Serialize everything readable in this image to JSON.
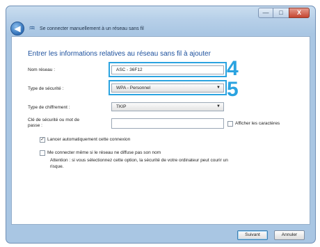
{
  "window": {
    "title": "Se connecter manuellement à un réseau sans fil",
    "controls": {
      "minimize": "—",
      "maximize": "□",
      "close": "X"
    }
  },
  "form": {
    "heading": "Entrer les informations relatives au réseau sans fil à ajouter",
    "network_name": {
      "label": "Nom réseau :",
      "value": "ASC - 36F12"
    },
    "security_type": {
      "label": "Type de sécurité :",
      "value": "WPA - Personnel"
    },
    "encryption_type": {
      "label": "Type de chiffrement :",
      "value": "TKIP"
    },
    "security_key": {
      "label_line1": "Clé de sécurité ou mot de",
      "label_line2": "passe :",
      "value": ""
    },
    "show_chars": {
      "label": "Afficher les caractères",
      "checked": false
    },
    "auto_connect": {
      "label": "Lancer automatiquement cette connexion",
      "checked": true
    },
    "connect_hidden": {
      "label": "Me connecter même si le réseau ne diffuse pas son nom",
      "checked": false,
      "warning_line1": "Attention : si vous sélectionnez cette option, la sécurité de votre ordinateur peut courir un",
      "warning_line2": "risque."
    }
  },
  "callouts": {
    "network_name": "4",
    "security_type": "5"
  },
  "buttons": {
    "next": "Suivant",
    "cancel": "Annuler"
  },
  "colors": {
    "highlight": "#2aa3e0",
    "heading": "#1b4f9c"
  }
}
